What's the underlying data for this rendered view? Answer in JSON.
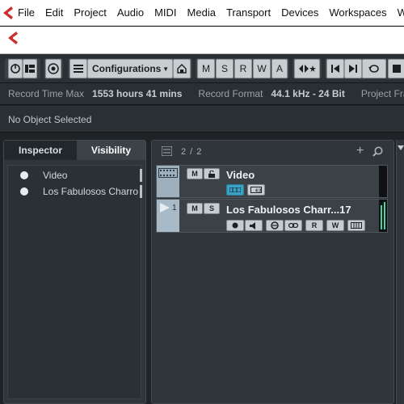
{
  "menu": [
    "File",
    "Edit",
    "Project",
    "Audio",
    "MIDI",
    "Media",
    "Transport",
    "Devices",
    "Workspaces",
    "Wi"
  ],
  "toolbar": {
    "configurations_label": "Configurations",
    "m": "M",
    "s": "S",
    "r": "R",
    "w": "W",
    "a": "A"
  },
  "infoline": {
    "record_time_label": "Record Time Max",
    "record_time_value": "1553 hours 41 mins",
    "record_format_label": "Record Format",
    "record_format_value": "44.1 kHz - 24 Bit",
    "project_frame_label": "Project Fram"
  },
  "status": {
    "no_object": "No Object Selected"
  },
  "left_panel": {
    "tabs": [
      "Inspector",
      "Visibility"
    ],
    "active_tab": "Visibility",
    "items": [
      {
        "label": "Video"
      },
      {
        "label": "Los Fabulosos Charro"
      }
    ]
  },
  "tracklist": {
    "count": "2 / 2",
    "tracks": [
      {
        "name": "Video",
        "number": ""
      },
      {
        "name": "Los Fabulosos Charr...17",
        "number": "1"
      }
    ],
    "buttons": {
      "m": "M",
      "s": "S",
      "r": "R",
      "w": "W"
    }
  },
  "colors": {
    "accent_blue": "#3ca1c4",
    "cubase_red": "#c8312c",
    "meter_green": "#4ad3a0"
  }
}
